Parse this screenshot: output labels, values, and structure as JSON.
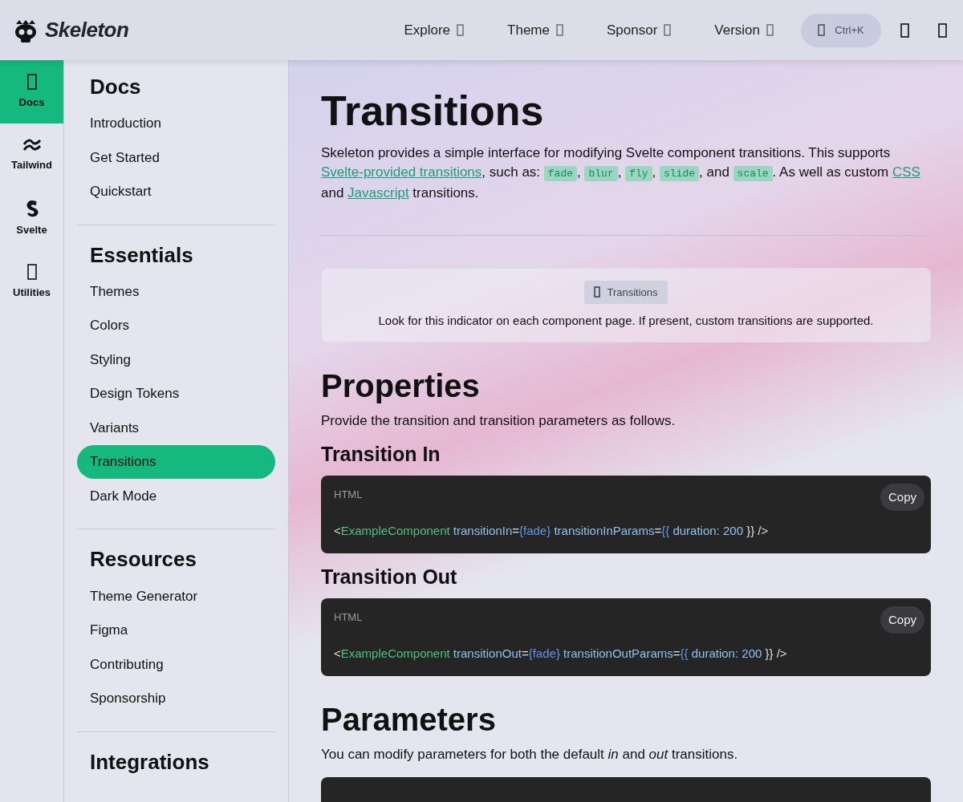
{
  "header": {
    "logo": "Skeleton",
    "nav": [
      {
        "label": "Explore"
      },
      {
        "label": "Theme"
      },
      {
        "label": "Sponsor"
      },
      {
        "label": "Version"
      }
    ],
    "search": {
      "shortcut": "Ctrl+K"
    }
  },
  "rail": [
    {
      "label": "Docs",
      "kind": "glyph",
      "selected": true
    },
    {
      "label": "Tailwind",
      "kind": "tailwind",
      "selected": false
    },
    {
      "label": "Svelte",
      "kind": "svelte",
      "selected": false
    },
    {
      "label": "Utilities",
      "kind": "glyph",
      "selected": false
    }
  ],
  "sidebar": {
    "sections": [
      {
        "title": "Docs",
        "items": [
          {
            "label": "Introduction",
            "selected": false
          },
          {
            "label": "Get Started",
            "selected": false
          },
          {
            "label": "Quickstart",
            "selected": false
          }
        ]
      },
      {
        "title": "Essentials",
        "items": [
          {
            "label": "Themes",
            "selected": false
          },
          {
            "label": "Colors",
            "selected": false
          },
          {
            "label": "Styling",
            "selected": false
          },
          {
            "label": "Design Tokens",
            "selected": false
          },
          {
            "label": "Variants",
            "selected": false
          },
          {
            "label": "Transitions",
            "selected": true
          },
          {
            "label": "Dark Mode",
            "selected": false
          }
        ]
      },
      {
        "title": "Resources",
        "items": [
          {
            "label": "Theme Generator",
            "selected": false
          },
          {
            "label": "Figma",
            "selected": false
          },
          {
            "label": "Contributing",
            "selected": false
          },
          {
            "label": "Sponsorship",
            "selected": false
          }
        ]
      },
      {
        "title": "Integrations"
      }
    ]
  },
  "main": {
    "blocks": [
      {
        "kind": "h1",
        "text": "Transitions"
      },
      {
        "kind": "paragraph",
        "segments": [
          {
            "kind": "text",
            "text": "Skeleton provides a simple interface for modifying Svelte component transitions. This supports "
          },
          {
            "kind": "link",
            "text": "Svelte-provided transitions"
          },
          {
            "kind": "text",
            "text": ", such as: "
          },
          {
            "kind": "code",
            "text": "fade"
          },
          {
            "kind": "text",
            "text": ", "
          },
          {
            "kind": "code",
            "text": "blur"
          },
          {
            "kind": "text",
            "text": ", "
          },
          {
            "kind": "code",
            "text": "fly"
          },
          {
            "kind": "text",
            "text": ", "
          },
          {
            "kind": "code",
            "text": "slide"
          },
          {
            "kind": "text",
            "text": ", and "
          },
          {
            "kind": "code",
            "text": "scale"
          },
          {
            "kind": "text",
            "text": ". As well as custom "
          },
          {
            "kind": "link",
            "text": "CSS"
          },
          {
            "kind": "text",
            "text": " and "
          },
          {
            "kind": "link",
            "text": "Javascript"
          },
          {
            "kind": "text",
            "text": " transitions."
          }
        ]
      },
      {
        "kind": "rule"
      },
      {
        "kind": "indicator",
        "badge": "Transitions",
        "note": "Look for this indicator on each component page. If present, custom transitions are supported."
      },
      {
        "kind": "h2",
        "text": "Properties"
      },
      {
        "kind": "text",
        "text": "Provide the transition and transition parameters as follows."
      },
      {
        "kind": "h3",
        "text": "Transition In"
      },
      {
        "kind": "code_block",
        "language": "HTML",
        "copy": "Copy",
        "tokens": [
          {
            "kind": "plain",
            "text": "<"
          },
          {
            "kind": "tag",
            "text": "ExampleComponent"
          },
          {
            "kind": "attr",
            "text": " transitionIn"
          },
          {
            "kind": "plain",
            "text": "="
          },
          {
            "kind": "brace",
            "text": "{fade}"
          },
          {
            "kind": "attr",
            "text": " transitionInParams"
          },
          {
            "kind": "plain",
            "text": "="
          },
          {
            "kind": "brace",
            "text": "{{"
          },
          {
            "kind": "attr",
            "text": " duration: 200"
          },
          {
            "kind": "plain",
            "text": " }} />"
          }
        ]
      },
      {
        "kind": "h3",
        "text": "Transition Out"
      },
      {
        "kind": "code_block",
        "language": "HTML",
        "copy": "Copy",
        "tokens": [
          {
            "kind": "plain",
            "text": "<"
          },
          {
            "kind": "tag",
            "text": "ExampleComponent"
          },
          {
            "kind": "attr",
            "text": " transitionOut"
          },
          {
            "kind": "plain",
            "text": "="
          },
          {
            "kind": "brace",
            "text": "{fade}"
          },
          {
            "kind": "attr",
            "text": " transitionOutParams"
          },
          {
            "kind": "plain",
            "text": "="
          },
          {
            "kind": "brace",
            "text": "{{"
          },
          {
            "kind": "attr",
            "text": " duration: 200"
          },
          {
            "kind": "plain",
            "text": " }} />"
          }
        ]
      },
      {
        "kind": "h2",
        "text": "Parameters"
      },
      {
        "kind": "paragraph",
        "segments": [
          {
            "kind": "text",
            "text": "You can modify parameters for both the default "
          },
          {
            "kind": "em",
            "text": "in"
          },
          {
            "kind": "text",
            "text": " and "
          },
          {
            "kind": "em",
            "text": "out"
          },
          {
            "kind": "text",
            "text": " transitions."
          }
        ]
      },
      {
        "kind": "code_stub"
      }
    ]
  }
}
